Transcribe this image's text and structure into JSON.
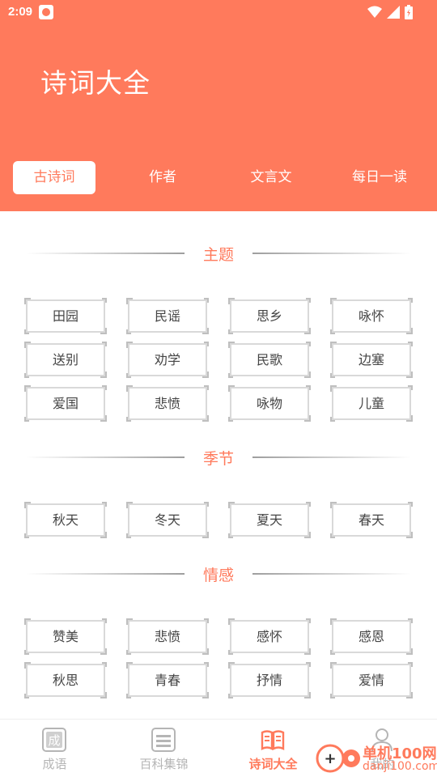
{
  "status_bar": {
    "time": "2:09"
  },
  "header": {
    "title": "诗词大全"
  },
  "tabs": [
    {
      "label": "古诗词",
      "active": true
    },
    {
      "label": "作者",
      "active": false
    },
    {
      "label": "文言文",
      "active": false
    },
    {
      "label": "每日一读",
      "active": false
    }
  ],
  "sections": [
    {
      "title": "主题",
      "tags": [
        "田园",
        "民谣",
        "思乡",
        "咏怀",
        "送别",
        "劝学",
        "民歌",
        "边塞",
        "爱国",
        "悲愤",
        "咏物",
        "儿童"
      ]
    },
    {
      "title": "季节",
      "tags": [
        "秋天",
        "冬天",
        "夏天",
        "春天"
      ]
    },
    {
      "title": "情感",
      "tags": [
        "赞美",
        "悲愤",
        "感怀",
        "感恩",
        "秋思",
        "青春",
        "抒情",
        "爱情"
      ]
    }
  ],
  "bottom_nav": [
    {
      "label": "成语",
      "icon": "idiom-icon",
      "active": false
    },
    {
      "label": "百科集锦",
      "icon": "encyclopedia-icon",
      "active": false
    },
    {
      "label": "诗词大全",
      "icon": "book-open-icon",
      "active": true
    },
    {
      "label": "我的",
      "icon": "user-icon",
      "active": false
    }
  ],
  "watermark": {
    "line1": "单机100网",
    "line2": "danji100.com"
  },
  "colors": {
    "accent": "#FF7A5C",
    "tag_border": "#d9d9d9",
    "inactive_nav": "#b5b5b5"
  }
}
